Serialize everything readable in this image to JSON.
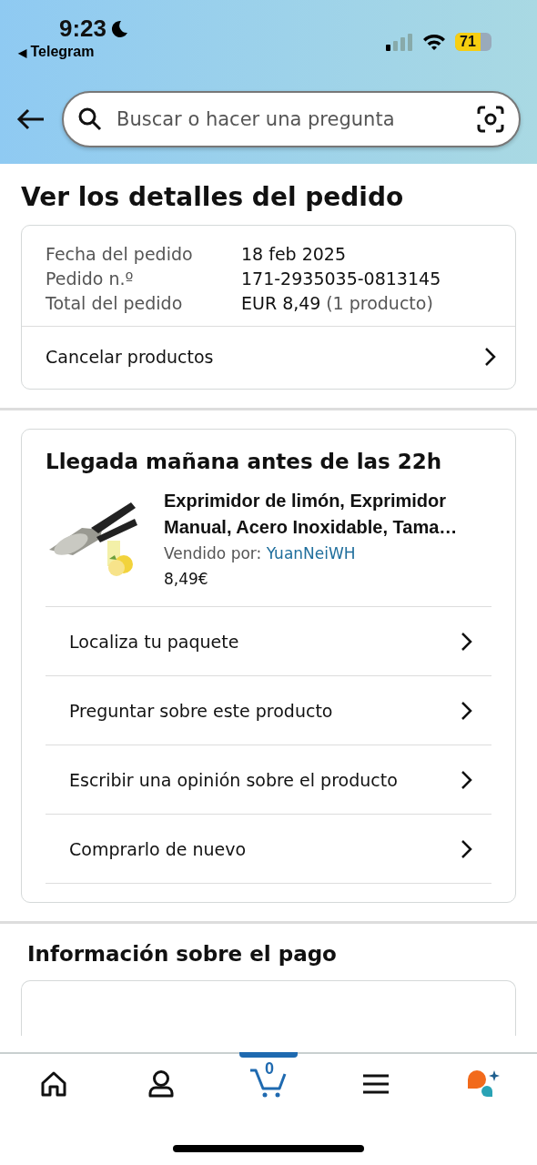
{
  "status_bar": {
    "time": "9:23",
    "back_app": "Telegram",
    "back_glyph": "◀",
    "battery": "71",
    "do_not_disturb": true
  },
  "search": {
    "placeholder": "Buscar o hacer una pregunta"
  },
  "page_title": "Ver los detalles del pedido",
  "order_summary": {
    "rows": [
      {
        "label": "Fecha del pedido",
        "value": "18 feb 2025"
      },
      {
        "label": "Pedido n.º",
        "value": "171-2935035-0813145"
      },
      {
        "label": "Total del pedido",
        "value": "EUR 8,49",
        "note": "(1 producto)"
      }
    ],
    "action": "Cancelar productos"
  },
  "shipment": {
    "heading": "Llegada mañana antes de las 22h",
    "product": {
      "title": "Exprimidor de limón, Exprimidor Manual, Acero Inoxidable, Tama…",
      "seller_label": "Vendido por:",
      "seller": "YuanNeiWH",
      "price": "8,49€"
    },
    "actions": [
      "Localiza tu paquete",
      "Preguntar sobre este producto",
      "Escribir una opinión sobre el producto",
      "Comprarlo de nuevo"
    ]
  },
  "payment": {
    "heading": "Información sobre el pago"
  },
  "bottom_nav": [
    {
      "kind": "home",
      "selected": false
    },
    {
      "kind": "account",
      "selected": false
    },
    {
      "kind": "cart",
      "selected": true,
      "count": "0"
    },
    {
      "kind": "menu",
      "selected": false
    },
    {
      "kind": "assistant",
      "selected": false
    }
  ]
}
